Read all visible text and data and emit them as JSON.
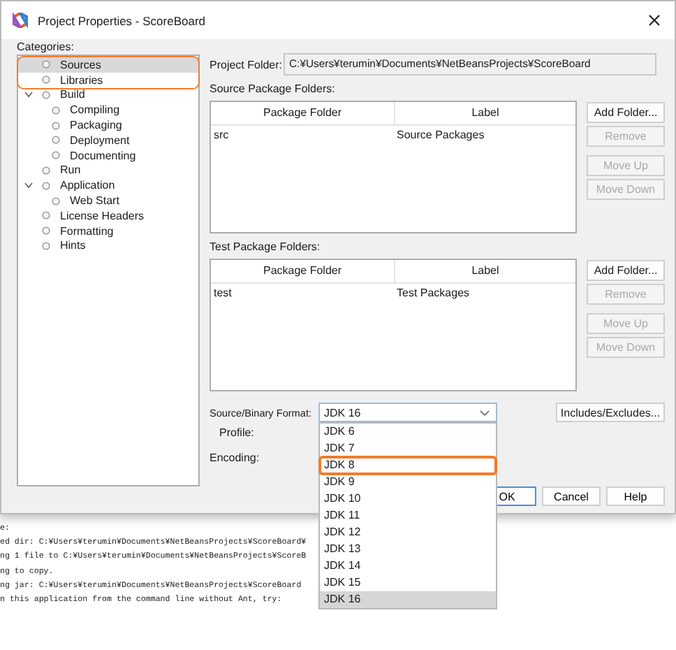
{
  "window": {
    "title": "Project Properties - ScoreBoard"
  },
  "categories": {
    "label": "Categories:",
    "items": [
      {
        "label": "Sources",
        "selected": true,
        "highlighted": true
      },
      {
        "label": "Libraries",
        "selected": false,
        "highlighted": true
      },
      {
        "label": "Build",
        "selected": false,
        "highlighted": false,
        "expanded": true,
        "children": [
          {
            "label": "Compiling",
            "selected": false
          },
          {
            "label": "Packaging",
            "selected": false
          },
          {
            "label": "Deployment",
            "selected": false
          },
          {
            "label": "Documenting",
            "selected": false
          }
        ]
      },
      {
        "label": "Run",
        "selected": false,
        "highlighted": false
      },
      {
        "label": "Application",
        "selected": false,
        "highlighted": false,
        "expanded": true,
        "children": [
          {
            "label": "Web Start",
            "selected": false
          }
        ]
      },
      {
        "label": "License Headers",
        "selected": false,
        "highlighted": false
      },
      {
        "label": "Formatting",
        "selected": false,
        "highlighted": false
      },
      {
        "label": "Hints",
        "selected": false,
        "highlighted": false
      }
    ]
  },
  "project_folder": {
    "label": "Project Folder:",
    "value": "C:¥Users¥terumin¥Documents¥NetBeansProjects¥ScoreBoard"
  },
  "folder_sections": [
    {
      "label": "Source Package Folders:",
      "columns": [
        "Package Folder",
        "Label"
      ],
      "rows": [
        [
          "src",
          "Source Packages"
        ]
      ],
      "buttons": [
        {
          "label": "Add Folder...",
          "disabled": false
        },
        {
          "label": "Remove",
          "disabled": true
        },
        {
          "label": "Move Up",
          "disabled": true
        },
        {
          "label": "Move Down",
          "disabled": true
        }
      ]
    },
    {
      "label": "Test Package Folders:",
      "columns": [
        "Package Folder",
        "Label"
      ],
      "rows": [
        [
          "test",
          "Test Packages"
        ]
      ],
      "buttons": [
        {
          "label": "Add Folder...",
          "disabled": false
        },
        {
          "label": "Remove",
          "disabled": true
        },
        {
          "label": "Move Up",
          "disabled": true
        },
        {
          "label": "Move Down",
          "disabled": true
        }
      ]
    }
  ],
  "format": {
    "label": "Source/Binary Format:",
    "value": "JDK 16",
    "expanded": true,
    "options": [
      {
        "label": "JDK 6",
        "selected": false,
        "highlighted": false
      },
      {
        "label": "JDK 7",
        "selected": false,
        "highlighted": false
      },
      {
        "label": "JDK 8",
        "selected": false,
        "highlighted": true
      },
      {
        "label": "JDK 9",
        "selected": false,
        "highlighted": false
      },
      {
        "label": "JDK 10",
        "selected": false,
        "highlighted": false
      },
      {
        "label": "JDK 11",
        "selected": false,
        "highlighted": false
      },
      {
        "label": "JDK 12",
        "selected": false,
        "highlighted": false
      },
      {
        "label": "JDK 13",
        "selected": false,
        "highlighted": false
      },
      {
        "label": "JDK 14",
        "selected": false,
        "highlighted": false
      },
      {
        "label": "JDK 15",
        "selected": false,
        "highlighted": false
      },
      {
        "label": "JDK 16",
        "selected": true,
        "highlighted": false
      }
    ]
  },
  "includes_button": "Includes/Excludes...",
  "profile_label": "Profile:",
  "encoding_label": "Encoding:",
  "dialog_buttons": [
    {
      "label": "OK",
      "default": true
    },
    {
      "label": "Cancel",
      "default": false
    },
    {
      "label": "Help",
      "default": false
    }
  ],
  "console": {
    "lines": [
      "e:",
      "ed dir: C:¥Users¥terumin¥Documents¥NetBeansProjects¥ScoreBoard¥",
      "ng 1 file to C:¥Users¥terumin¥Documents¥NetBeansProjects¥ScoreB",
      "ng to copy.",
      "ng jar: C:¥Users¥terumin¥Documents¥NetBeansProjects¥ScoreBoard",
      "n this application from the command line without Ant, try:"
    ]
  }
}
